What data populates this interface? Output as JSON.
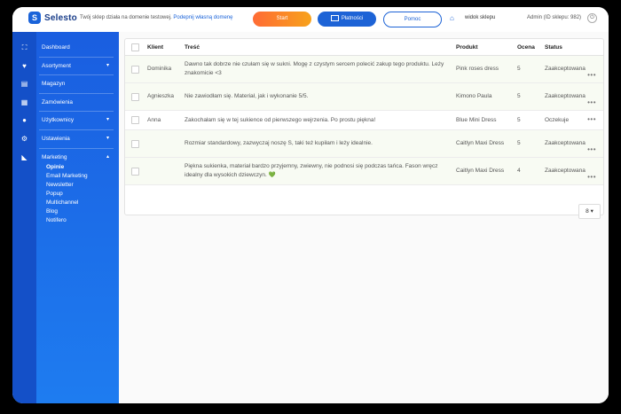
{
  "topbar": {
    "logo": "Selesto",
    "notice": "Twój sklep działa na domenie testowej.",
    "notice_link": "Podepnij własną domenę",
    "start": "Start",
    "payments": "Płatności",
    "help": "Pomoc",
    "view_shop": "widok sklepu",
    "admin": "Admin (ID sklepu: 982)"
  },
  "sidebar": {
    "items": [
      {
        "label": "Dashboard",
        "icon": "grid-icon",
        "chevron": ""
      },
      {
        "label": "Asortyment",
        "icon": "shirt-icon",
        "chevron": "▾"
      },
      {
        "label": "Magazyn",
        "icon": "warehouse-icon",
        "chevron": ""
      },
      {
        "label": "Zamówienia",
        "icon": "orders-icon",
        "chevron": ""
      },
      {
        "label": "Użytkownicy",
        "icon": "user-icon",
        "chevron": "▾"
      },
      {
        "label": "Ustawienia",
        "icon": "gear-icon",
        "chevron": "▾"
      },
      {
        "label": "Marketing",
        "icon": "megaphone-icon",
        "chevron": "▴"
      }
    ],
    "submenu": [
      "Opinie",
      "Email Marketing",
      "Newsletter",
      "Popup",
      "Multichannel",
      "Blog",
      "Notifero"
    ]
  },
  "table": {
    "headers": [
      "Klient",
      "Treść",
      "Produkt",
      "Ocena",
      "Status"
    ],
    "rows": [
      {
        "client": "Dominika",
        "content": "Dawno tak dobrze nie czułam się w sukni. Mogę z czystym sercem polecić zakup tego produktu. Leży znakomicie <3",
        "product": "Pink roses dress",
        "score": "5",
        "status": "Zaakceptowana"
      },
      {
        "client": "Agnieszka",
        "content": "Nie zawiodłam się. Materiał, jak i wykonanie 5/5.",
        "product": "Kimono Paula",
        "score": "5",
        "status": "Zaakceptowana"
      },
      {
        "client": "Anna",
        "content": "Zakochałam się w tej sukience od pierwszego wejrzenia. Po prostu piękna!",
        "product": "Blue Mini Dress",
        "score": "5",
        "status": "Oczekuje"
      },
      {
        "client": "",
        "content": "Rozmiar standardowy, zazwyczaj noszę S, taki też kupiłam i leży idealnie.",
        "product": "Caitlyn Maxi Dress",
        "score": "5",
        "status": "Zaakceptowana"
      },
      {
        "client": "",
        "content": "Piękna sukienka, materiał bardzo przyjemny, zwiewny, nie podnosi się podczas tańca. Fason wręcz idealny dla wysokich dziewczyn. 💚",
        "product": "Caitlyn Maxi Dress",
        "score": "4",
        "status": "Zaakceptowana"
      }
    ],
    "dots": "•••"
  },
  "pager": {
    "value": "8"
  },
  "colors": {
    "brand": "#1a63d9",
    "sidebar": "#1a5ee0",
    "start": "#ff6b35"
  }
}
